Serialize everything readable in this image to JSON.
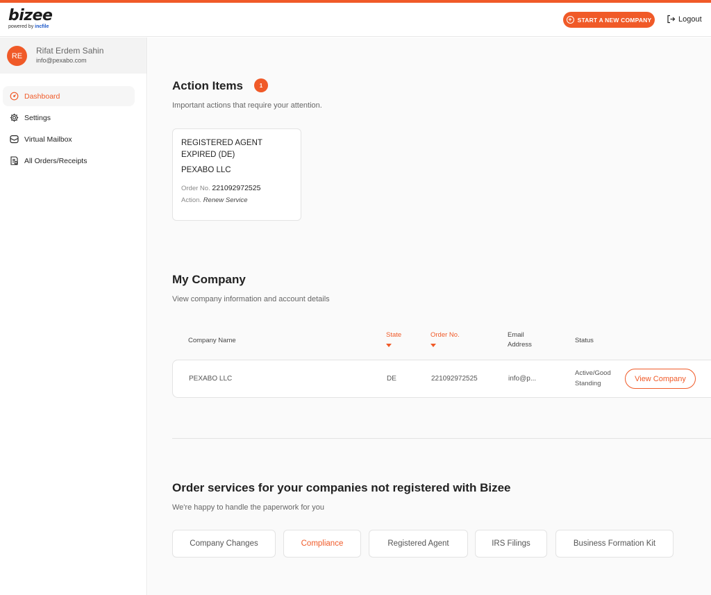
{
  "header": {
    "logo_text": "bizee",
    "logo_sub_prefix": "powered by",
    "logo_sub_brand": "incfile",
    "start_company_label": "START A NEW COMPANY",
    "logout_label": "Logout"
  },
  "user": {
    "initials": "RE",
    "name": "Rifat Erdem Sahin",
    "email": "info@pexabo.com"
  },
  "sidebar": {
    "items": [
      {
        "label": "Dashboard",
        "icon": "dashboard-icon",
        "active": true
      },
      {
        "label": "Settings",
        "icon": "gear-icon",
        "active": false
      },
      {
        "label": "Virtual Mailbox",
        "icon": "mailbox-icon",
        "active": false
      },
      {
        "label": "All Orders/Receipts",
        "icon": "receipt-icon",
        "active": false
      }
    ]
  },
  "action_items": {
    "title": "Action Items",
    "count": "1",
    "subtitle": "Important actions that require your attention.",
    "card": {
      "title": "REGISTERED AGENT EXPIRED (DE)",
      "company": "PEXABO LLC",
      "order_label": "Order No.",
      "order_value": "221092972525",
      "action_label": "Action.",
      "action_value": "Renew Service"
    }
  },
  "my_company": {
    "title": "My Company",
    "subtitle": "View company information and account details",
    "columns": {
      "company_name": "Company Name",
      "state": "State",
      "order_no": "Order No.",
      "email": "Email Address",
      "status": "Status"
    },
    "rows": [
      {
        "company_name": "PEXABO LLC",
        "state": "DE",
        "order_no": "221092972525",
        "email": "info@p...",
        "status": "Active/Good Standing",
        "action_label": "View Company"
      }
    ]
  },
  "order_services": {
    "title": "Order services for your companies not registered with Bizee",
    "subtitle": "We're happy to handle the paperwork for you",
    "buttons": [
      {
        "label": "Company Changes",
        "active": false
      },
      {
        "label": "Compliance",
        "active": true
      },
      {
        "label": "Registered Agent",
        "active": false
      },
      {
        "label": "IRS Filings",
        "active": false
      },
      {
        "label": "Business Formation Kit",
        "active": false
      }
    ]
  },
  "colors": {
    "accent": "#f05a28",
    "brand_blue": "#1a56c8"
  }
}
